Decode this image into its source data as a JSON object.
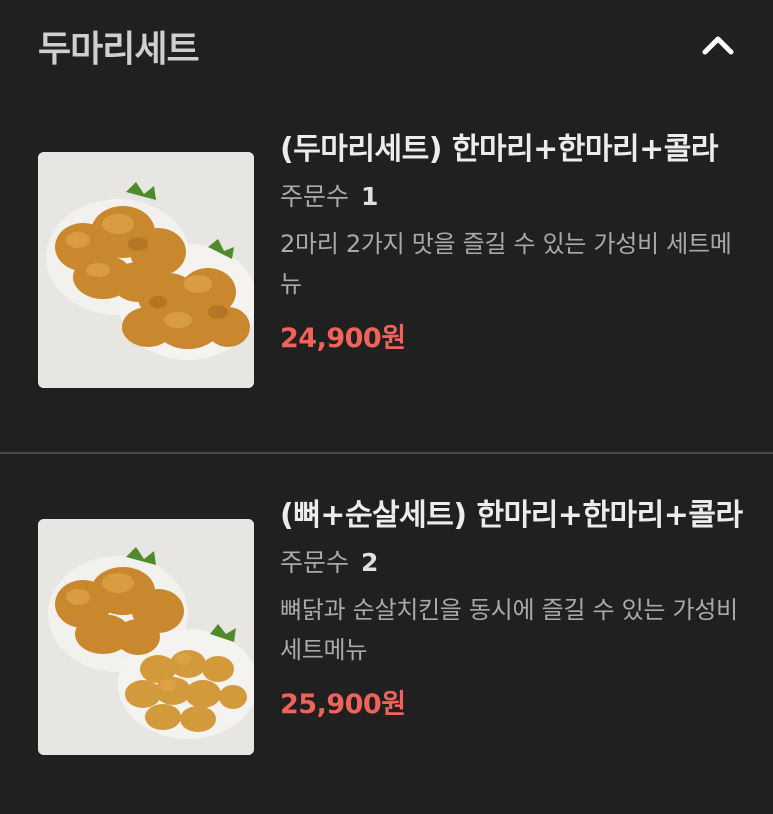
{
  "section": {
    "title": "두마리세트",
    "toggle_icon": "chevron-up-icon"
  },
  "items": [
    {
      "name": "(두마리세트) 한마리+한마리+콜라",
      "order_label": "주문수",
      "order_count": "1",
      "description": "2마리 2가지 맛을 즐길 수 있는 가성비 세트메뉴",
      "price": "24,900원",
      "image_icon": "fried-chicken-photo"
    },
    {
      "name": "(뼈+순살세트) 한마리+한마리+콜라",
      "order_label": "주문수",
      "order_count": "2",
      "description": "뼈닭과 순살치킨을 동시에 즐길 수 있는 가성비 세트메뉴",
      "price": "25,900원",
      "image_icon": "fried-chicken-photo"
    }
  ],
  "colors": {
    "background": "#202020",
    "price": "#f0625a",
    "divider": "#4a4a4a"
  }
}
